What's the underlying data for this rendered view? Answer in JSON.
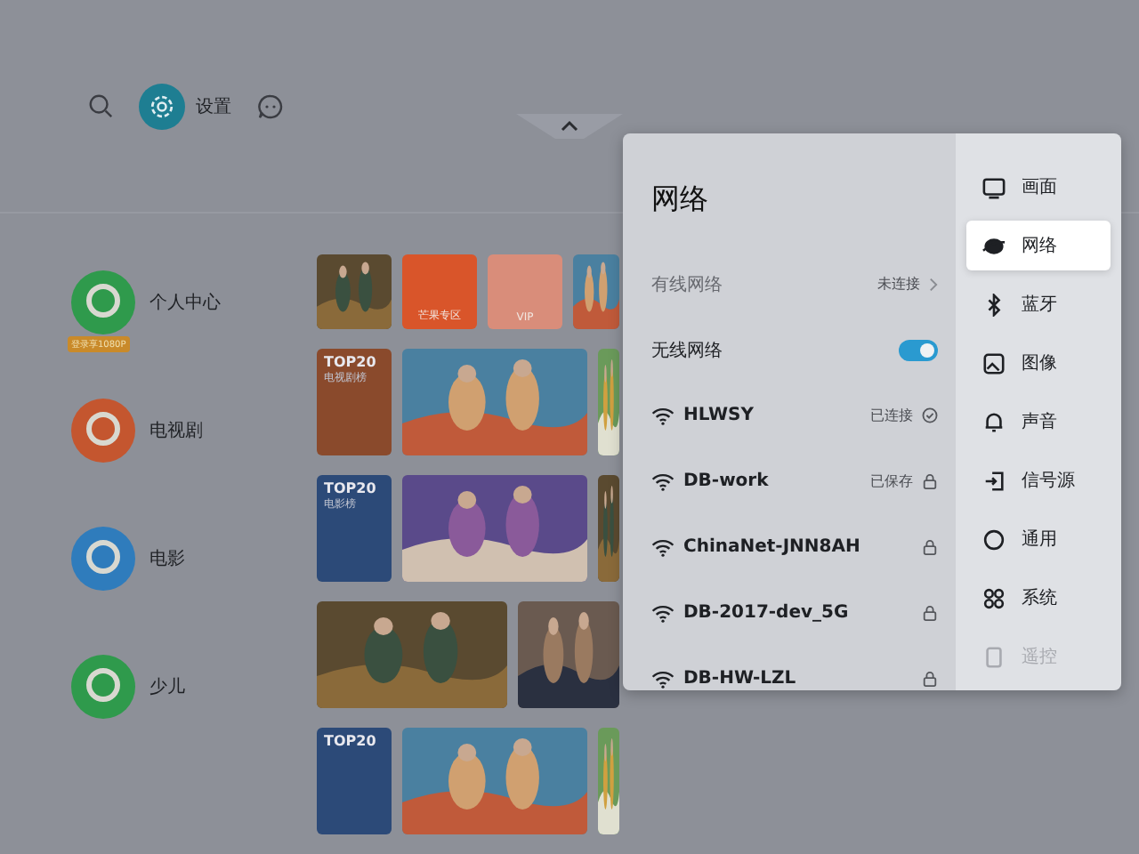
{
  "top_bar": {
    "settings_label": "设置"
  },
  "categories": [
    {
      "label": "个人中心",
      "color": "#2f9a4c",
      "badge": "登录享1080P"
    },
    {
      "label": "电视剧",
      "color": "#c4562f"
    },
    {
      "label": "电影",
      "color": "#2f7cbc"
    },
    {
      "label": "少儿",
      "color": "#2f9a4c"
    }
  ],
  "tile_rows": [
    {
      "tiles": [
        {
          "kind": "picture"
        },
        {
          "kind": "brand",
          "label": "芒果专区",
          "color": "#d9552a"
        },
        {
          "kind": "brand",
          "label": "VIP",
          "color": "#d98d7a"
        },
        {
          "kind": "picture"
        }
      ]
    },
    {
      "tiles": [
        {
          "kind": "top20",
          "title": "TOP20",
          "subtitle": "电视剧榜",
          "color": "#8a4a2c"
        },
        {
          "kind": "picture"
        },
        {
          "kind": "picture"
        }
      ]
    },
    {
      "tiles": [
        {
          "kind": "top20",
          "title": "TOP20",
          "subtitle": "电影榜",
          "color": "#2c4a78"
        },
        {
          "kind": "picture"
        },
        {
          "kind": "picture"
        }
      ]
    },
    {
      "tiles": [
        {
          "kind": "picture"
        },
        {
          "kind": "picture"
        }
      ]
    },
    {
      "tiles": [
        {
          "kind": "top20",
          "title": "TOP20",
          "color": "#2c4a78"
        },
        {
          "kind": "picture"
        },
        {
          "kind": "picture"
        }
      ]
    }
  ],
  "panel": {
    "title": "网络",
    "wired": {
      "label": "有线网络",
      "status": "未连接"
    },
    "wireless": {
      "label": "无线网络",
      "on": true
    },
    "networks": [
      {
        "name": "HLWSY",
        "status": "已连接",
        "kind": "connected"
      },
      {
        "name": "DB-work",
        "status": "已保存",
        "kind": "saved"
      },
      {
        "name": "ChinaNet-JNN8AH",
        "kind": "locked"
      },
      {
        "name": "DB-2017-dev_5G",
        "kind": "locked"
      },
      {
        "name": "DB-HW-LZL",
        "kind": "locked"
      }
    ],
    "menu": [
      {
        "label": "画面",
        "selected": false
      },
      {
        "label": "网络",
        "selected": true
      },
      {
        "label": "蓝牙",
        "selected": false
      },
      {
        "label": "图像",
        "selected": false
      },
      {
        "label": "声音",
        "selected": false
      },
      {
        "label": "信号源",
        "selected": false
      },
      {
        "label": "通用",
        "selected": false
      },
      {
        "label": "系统",
        "selected": false
      },
      {
        "label": "遥控",
        "selected": false,
        "disabled": true
      }
    ]
  }
}
